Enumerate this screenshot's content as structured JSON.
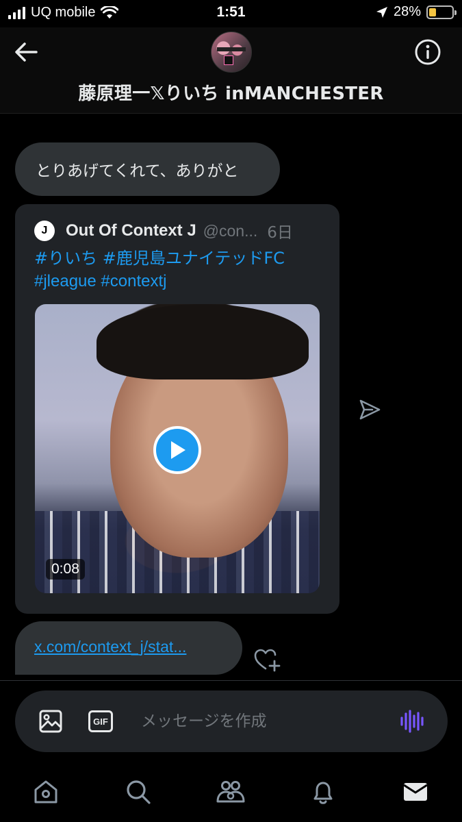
{
  "status_bar": {
    "carrier": "UQ mobile",
    "time": "1:51",
    "battery_percent": "28%",
    "battery_level": 0.28
  },
  "header": {
    "title": "藤原理一𝕏りいち inMANCHESTER"
  },
  "messages": {
    "text_message": "とりあげてくれて、ありがと",
    "tweet_card": {
      "logo_letter": "J",
      "author_name": "Out Of Context J",
      "author_handle": "@con...",
      "age": "6日",
      "hashtags_line1": "#りいち #鹿児島ユナイテッドFC",
      "hashtags_line2": "#jleague #contextj",
      "video_duration": "0:08"
    },
    "link_message": "x.com/context_j/stat..."
  },
  "composer": {
    "gif_label": "GIF",
    "placeholder": "メッセージを作成"
  },
  "colors": {
    "background": "#000000",
    "bubble": "#2f3336",
    "card": "#202327",
    "accent": "#1d9bf0",
    "voice_accent": "#7856ff",
    "muted": "#71767b"
  },
  "icons": {
    "back": "arrow-left-icon",
    "info": "info-icon",
    "share": "send-icon",
    "react": "heart-plus-icon",
    "image": "image-icon",
    "gif": "gif-icon",
    "voice": "voice-wave-icon",
    "nav": [
      "home-icon",
      "search-icon",
      "communities-icon",
      "bell-icon",
      "mail-icon"
    ]
  }
}
